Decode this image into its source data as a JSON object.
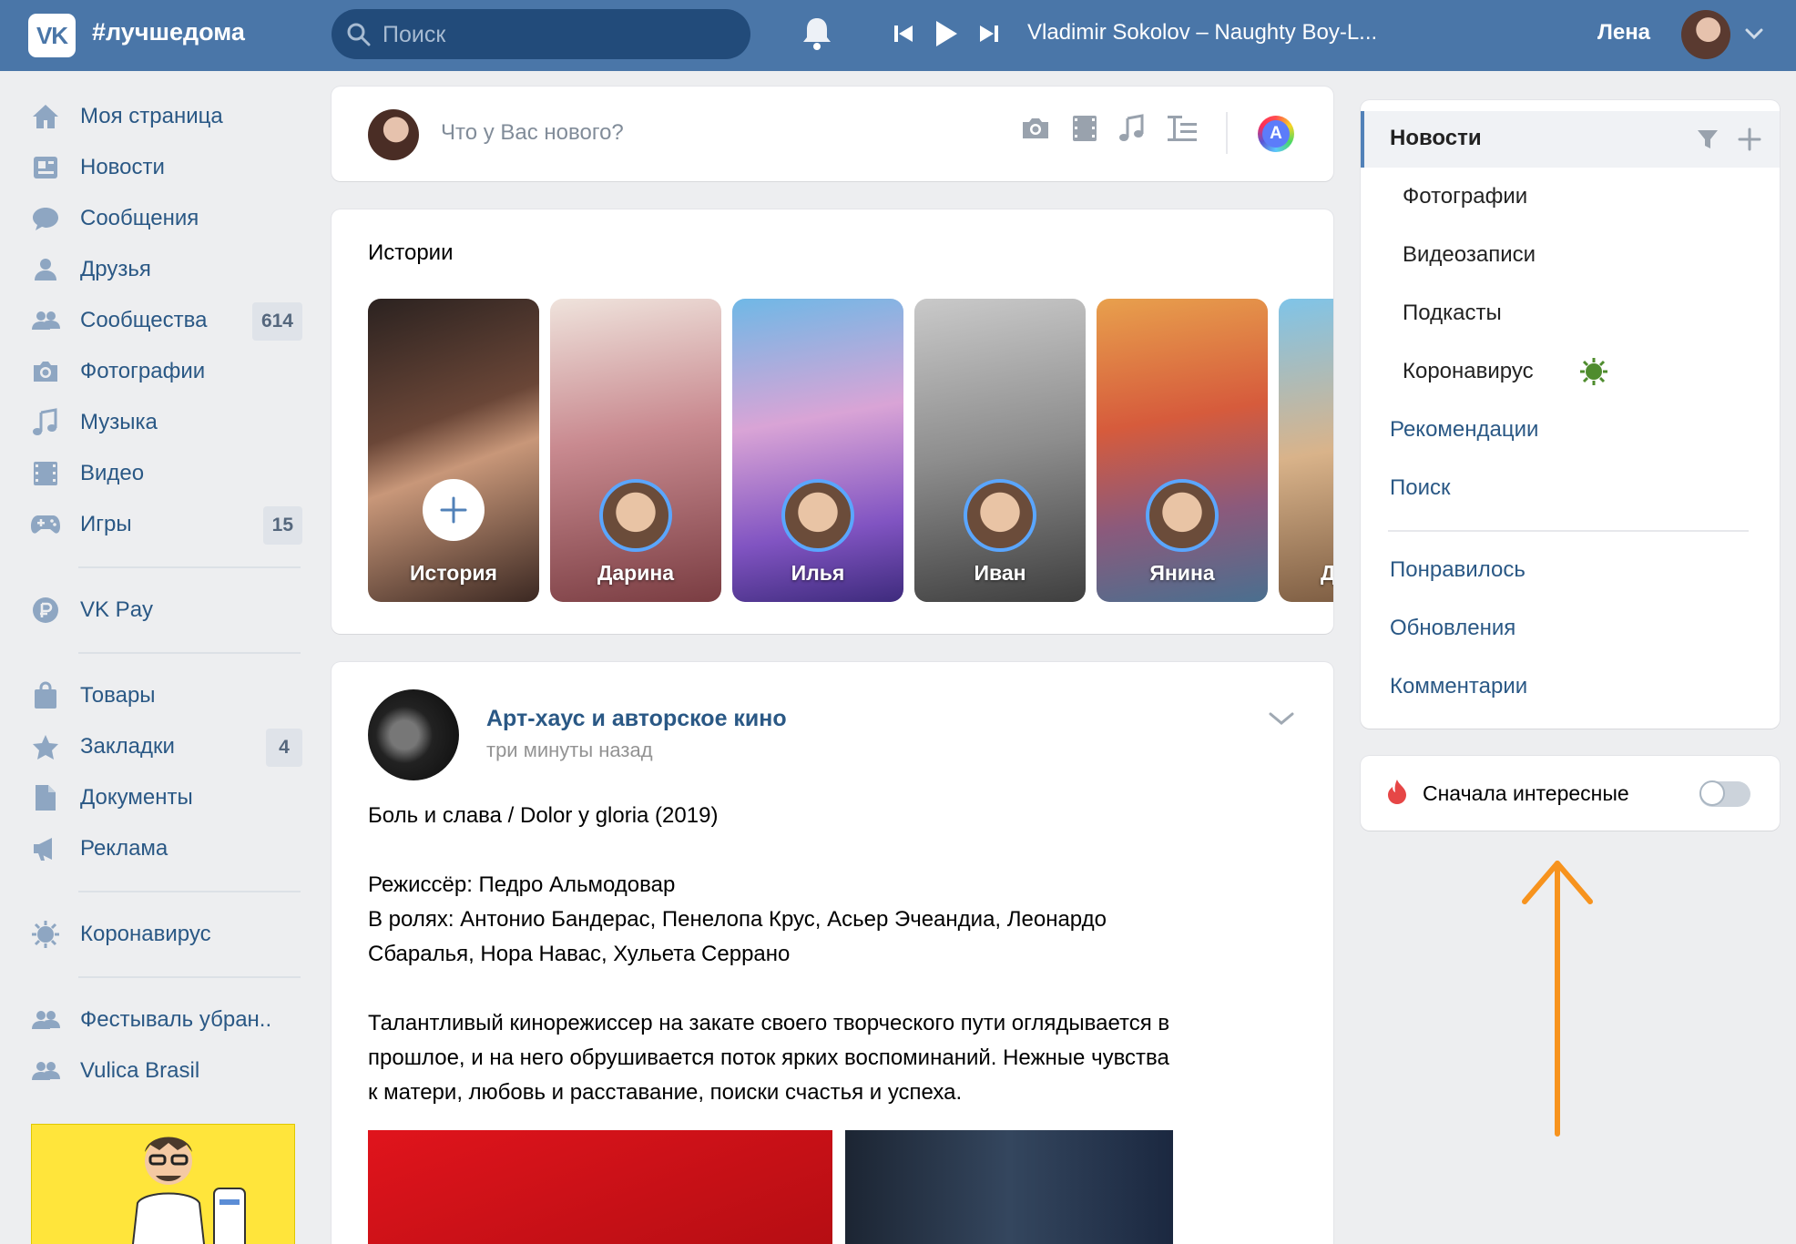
{
  "header": {
    "logo_text": "VK",
    "brand_hashtag": "#лучшедома",
    "search_placeholder": "Поиск",
    "now_playing": "Vladimir Sokolov – Naughty Boy-L...",
    "user_name": "Лена"
  },
  "sidebar": {
    "items": [
      {
        "label": "Моя страница",
        "icon": "home-icon"
      },
      {
        "label": "Новости",
        "icon": "news-icon"
      },
      {
        "label": "Сообщения",
        "icon": "messages-icon"
      },
      {
        "label": "Друзья",
        "icon": "friends-icon"
      },
      {
        "label": "Сообщества",
        "icon": "communities-icon",
        "badge": "614"
      },
      {
        "label": "Фотографии",
        "icon": "camera-icon"
      },
      {
        "label": "Музыка",
        "icon": "music-icon"
      },
      {
        "label": "Видео",
        "icon": "video-icon"
      },
      {
        "label": "Игры",
        "icon": "games-icon",
        "badge": "15"
      }
    ],
    "pay": {
      "label": "VK Pay",
      "icon": "vkpay-icon"
    },
    "items2": [
      {
        "label": "Товары",
        "icon": "bag-icon"
      },
      {
        "label": "Закладки",
        "icon": "star-icon",
        "badge": "4"
      },
      {
        "label": "Документы",
        "icon": "document-icon"
      },
      {
        "label": "Реклама",
        "icon": "megaphone-icon"
      }
    ],
    "corona": {
      "label": "Коронавирус",
      "icon": "virus-icon"
    },
    "groups": [
      {
        "label": "Фестываль убран..",
        "icon": "group-icon"
      },
      {
        "label": "Vulica Brasil",
        "icon": "group-icon"
      }
    ]
  },
  "composer": {
    "placeholder": "Что у Вас нового?",
    "icons": [
      "camera-icon",
      "video-icon",
      "music-icon",
      "text-icon"
    ],
    "avatar_letter": "A"
  },
  "stories": {
    "title": "Истории",
    "items": [
      {
        "name": "История",
        "add": true
      },
      {
        "name": "Дарина"
      },
      {
        "name": "Илья"
      },
      {
        "name": "Иван"
      },
      {
        "name": "Янина"
      },
      {
        "name": "Д"
      }
    ]
  },
  "post": {
    "author": "Арт-хаус и авторское кино",
    "time": "три минуты назад",
    "lines": [
      "Боль и слава / Dolor y gloria (2019)",
      "",
      "Режиссёр: Педро Альмодовар",
      "В ролях: Антонио Бандерас, Пенелопа Крус, Асьер Эчеандиа, Леонардо",
      "Сбаралья, Нора Навас, Хульета Серрано",
      "",
      "Талантливый кинорежиссер на закате своего творческого пути оглядывается в",
      "прошлое, и на него обрушивается поток ярких воспоминаний. Нежные чувства",
      "к матери, любовь и расставание, поиски счастья и успеха."
    ]
  },
  "right_menu": {
    "active": "Новости",
    "subs": [
      "Фотографии",
      "Видеозаписи",
      "Подкасты",
      "Коронавирус"
    ],
    "links1": [
      "Рекомендации",
      "Поиск"
    ],
    "links2": [
      "Понравилось",
      "Обновления",
      "Комментарии"
    ]
  },
  "toggle": {
    "label": "Сначала интересные",
    "on": false
  },
  "colors": {
    "header": "#4a76a8",
    "link": "#2a5885",
    "arrow": "#f7931e"
  }
}
